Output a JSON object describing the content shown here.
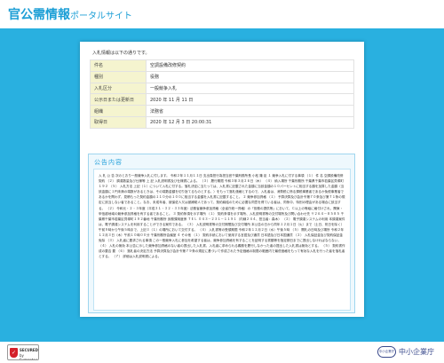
{
  "header": {
    "site_title_main": "官公需情報",
    "site_title_sub": "ポータルサイト"
  },
  "bid_info": {
    "intro": "入札情報は以下の通りです。",
    "rows": [
      {
        "label": "件名",
        "value": "空調設備改修契約"
      },
      {
        "label": "種別",
        "value": "役務"
      },
      {
        "label": "入札区分",
        "value": "一般競争入札"
      },
      {
        "label": "公示日または更新日",
        "value": "2020 年 11 月 11 日"
      },
      {
        "label": "組織",
        "value": "法務省"
      },
      {
        "label": "取得日",
        "value": "2020 年 12 月 3 日 20:00:31"
      }
    ]
  },
  "notice": {
    "title": "公告内容",
    "body": "入 札 公 告 次のとおり一般競争入札に付します。 令和２年１１月１１日 支出負担行為担当官千葉刑務所長 小松 隆 臣 １ 競争入札に付する事項 （１） 件 名 空調設備改修契約 （２） 調達数量及び仕様等 上 記 入札説明書及び仕様書による。 （３） 履行期限 令和３年３月２６日（木） （４） 納入場所 千葉刑務所 千葉県千葉市若葉区貝塚町１９２ （５） 入札方法 上記（１）について入札に付する。落札決定に当たっては、入札書に記載された金額に当該金額の１０パーセントに相当する額を加算した金額（当該金額に１円未満の端数があるときは、その端数金額を切り捨てるものとする。）をもって落札価格とするので、入札者は、消費税に係る課税事業者であるか免税事業者であるかを問わず、見積もった契約金額の１１０分の１００に相当する金額を入札書に記載すること。 ２ 競争参加資格 （１） 予算決算及び会計令第７０条及び第７１条の規定に該当しない者であること。なお、未成年者、被保佐人又は被補助人であって、契約締結のために必要な同意を得ている者は、同条中、特別の理由がある場合に該当する。 （２） 令和元・２・３年度（平成３１・３２・３３年度）法務省競争参加資格（全省庁統一資格）の「役務の提供等」において、Ｃ以上の等級に格付けされ、関東・甲信越地域の競争参加資格を有する者であること。 ３ 契約条項を示す場所 （１） 契約条項を示す場所、入札説明書等の交付場所及び問い合わせ先 〒２６４－８５８５ 千葉県千葉市若葉区貝塚町１９２番地 千葉刑務所 庶務課用度係 ＴＥＬ ０４３－２３１－１１９１（内線２４４、担当者：森木） （２） 電子調達システムの利用 本調達案件は、電子調達システムを利用することができる案件である。 （３） 入札説明書等の交付期間及び交付場所 本公告の日から同年１２月１日（火）まで（土日、祝日を除く）午前９時から午後５時まで、上記３（１）の場所において交付する。 （４） 入札書等の受領期限 令和２年１２月２日（水）午後５時 （５） 開札の日時及び場所 令和２年１２月３日（木）午前１０時００分 千葉刑務所会議室 ４ その他 （１） 契約手続において使用する言語及び通貨 日本語及び日本国通貨 （２） 入札保証金及び契約保証金 免除 （３） 入札者に要求される事項 この一般競争入札に参加を希望する者は、競争参加資格を有することを証明する書類等を指定期日までに提出しなければならない。 （４） 入札の無効 本公告に示した競争参加資格のない者の提出した入札書、入札者に求められる義務を履行しなかった者の提出した入札書は無効とする。 （５） 契約書作成の要否 要 （６） 落札者の決定方法 予算決算及び会計令第７９条の規定に基づいて作成された予定価格の制限の範囲内で最低価格をもって有効な入札を行った者を落札者とする。 （７） 詳細は入札説明書による。"
  },
  "footer": {
    "secured_line1": "SECURED",
    "secured_line2": "by Symantec",
    "agency_mark": "中小企業庁",
    "agency_name": "中小企業庁"
  }
}
